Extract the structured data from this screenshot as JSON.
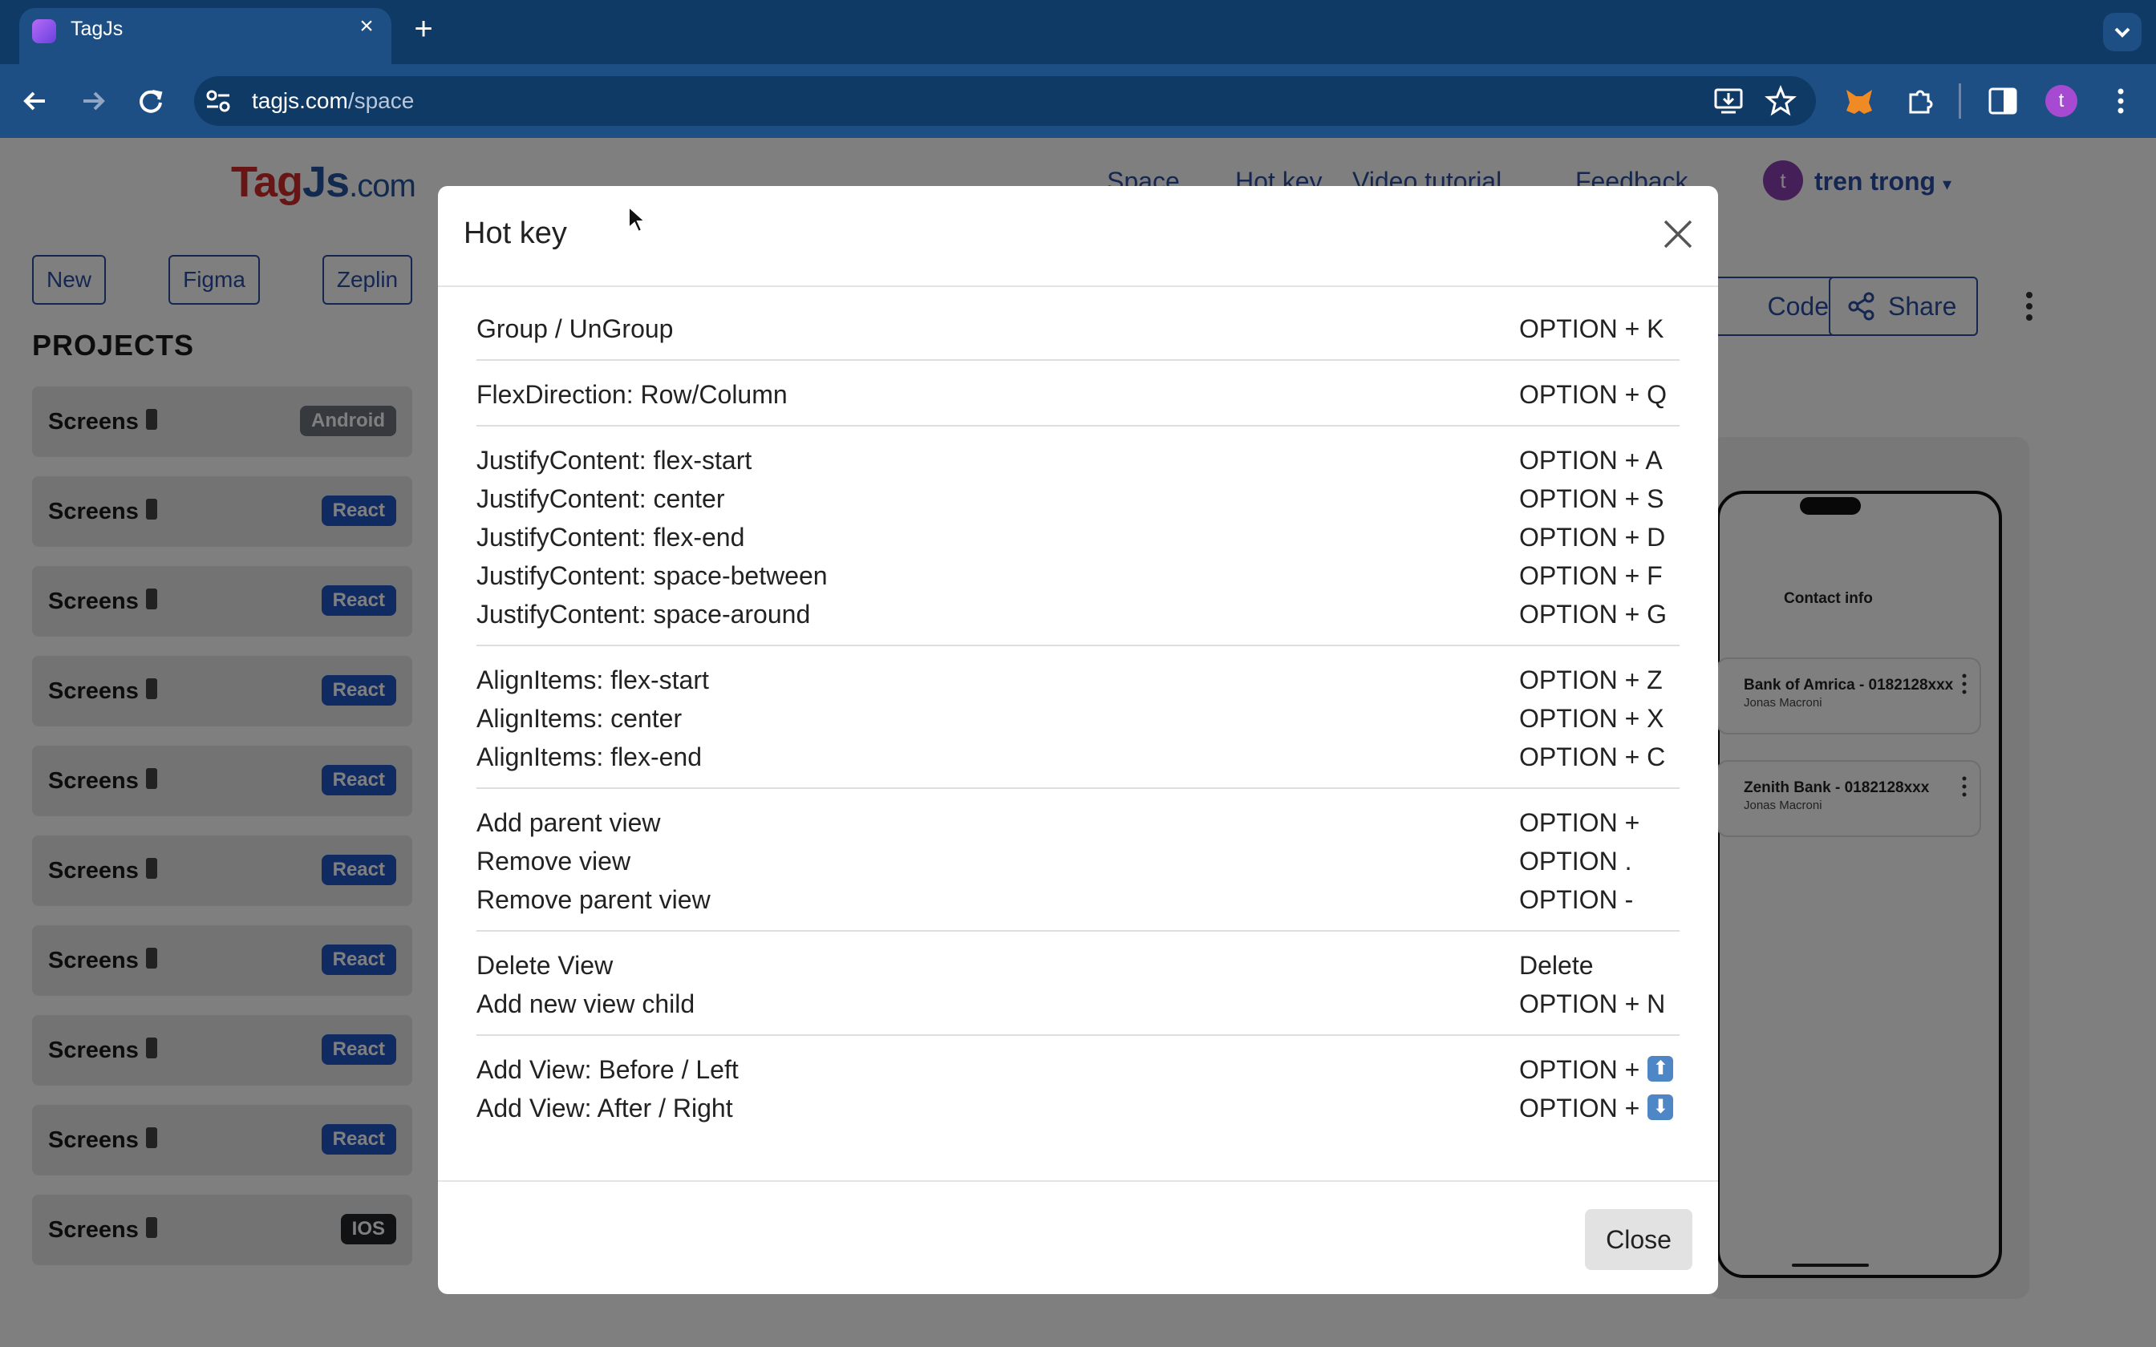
{
  "browser": {
    "tab_title": "TagJs",
    "url_host": "tagjs.com",
    "url_path": "/space",
    "profile_initial": "t"
  },
  "site": {
    "logo_tag": "Tag",
    "logo_js": "Js",
    "logo_dotcom": ".com",
    "nav": [
      "Space",
      "Hot key",
      "Video tutorial",
      "Feedback"
    ],
    "user_initial": "t",
    "user_name": "tren trong"
  },
  "sidebar": {
    "buttons": [
      "New",
      "Figma",
      "Zeplin"
    ],
    "projects_title": "PROJECTS",
    "projects": [
      {
        "name": "Screens",
        "badge": "Android",
        "color": "#6c757d"
      },
      {
        "name": "Screens",
        "badge": "React",
        "color": "#1f57c3"
      },
      {
        "name": "Screens",
        "badge": "React",
        "color": "#1f57c3"
      },
      {
        "name": "Screens",
        "badge": "React",
        "color": "#1f57c3"
      },
      {
        "name": "Screens",
        "badge": "React",
        "color": "#1f57c3"
      },
      {
        "name": "Screens",
        "badge": "React",
        "color": "#1f57c3"
      },
      {
        "name": "Screens",
        "badge": "React",
        "color": "#1f57c3"
      },
      {
        "name": "Screens",
        "badge": "React",
        "color": "#1f57c3"
      },
      {
        "name": "Screens",
        "badge": "React",
        "color": "#1f57c3"
      },
      {
        "name": "Screens",
        "badge": "IOS",
        "color": "#212529"
      }
    ]
  },
  "editor": {
    "code_label": "Code",
    "share_label": "Share",
    "contact_title": "Contact info",
    "cards": [
      {
        "title": "Bank of Amrica - 0182128xxx",
        "subtitle": "Jonas Macroni"
      },
      {
        "title": "Zenith Bank - 0182128xxx",
        "subtitle": "Jonas Macroni"
      }
    ]
  },
  "modal": {
    "title": "Hot key",
    "close_label": "Close",
    "groups": [
      [
        {
          "label": "Group / UnGroup",
          "key": "OPTION + K"
        }
      ],
      [
        {
          "label": "FlexDirection: Row/Column",
          "key": "OPTION + Q"
        }
      ],
      [
        {
          "label": "JustifyContent: flex-start",
          "key": "OPTION + A"
        },
        {
          "label": "JustifyContent: center",
          "key": "OPTION + S"
        },
        {
          "label": "JustifyContent: flex-end",
          "key": "OPTION + D"
        },
        {
          "label": "JustifyContent: space-between",
          "key": "OPTION + F"
        },
        {
          "label": "JustifyContent: space-around",
          "key": "OPTION + G"
        }
      ],
      [
        {
          "label": "AlignItems: flex-start",
          "key": "OPTION + Z"
        },
        {
          "label": "AlignItems: center",
          "key": "OPTION + X"
        },
        {
          "label": "AlignItems: flex-end",
          "key": "OPTION + C"
        }
      ],
      [
        {
          "label": "Add parent view",
          "key": "OPTION +"
        },
        {
          "label": "Remove view",
          "key": "OPTION ."
        },
        {
          "label": "Remove parent view",
          "key": "OPTION -"
        }
      ],
      [
        {
          "label": "Delete View",
          "key": "Delete"
        },
        {
          "label": "Add new view child",
          "key": "OPTION + N"
        }
      ],
      [
        {
          "label": "Add View: Before / Left",
          "key": "OPTION +",
          "arrow": "⬆"
        },
        {
          "label": "Add View: After / Right",
          "key": "OPTION +",
          "arrow": "⬇"
        }
      ]
    ]
  }
}
